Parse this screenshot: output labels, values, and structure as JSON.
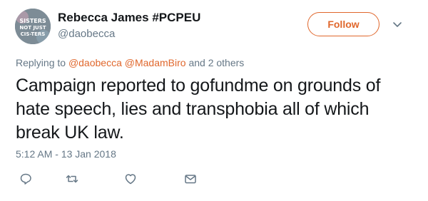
{
  "tweet": {
    "author": {
      "display_name": "Rebecca James #PCPEU",
      "handle": "@daobecca",
      "avatar_text": [
        "SISTERS",
        "NOT JUST",
        "CIS-TERS"
      ],
      "avatar_icon": "avatar-badge"
    },
    "follow_label": "Follow",
    "menu_icon": "chevron-down-icon",
    "reply": {
      "prefix": "Replying to",
      "mention_1": "@daobecca",
      "mention_2": "@MadamBiro",
      "suffix": "and 2 others"
    },
    "text": "Campaign reported to gofundme on grounds of hate speech, lies and transphobia all of which break UK law.",
    "timestamp": "5:12 AM - 13 Jan 2018",
    "actions": [
      "reply-icon",
      "retweet-icon",
      "like-icon",
      "direct-message-icon"
    ],
    "colors": {
      "accent": "#e0672c",
      "secondary_text": "#657786",
      "primary_text": "#14171a"
    }
  }
}
